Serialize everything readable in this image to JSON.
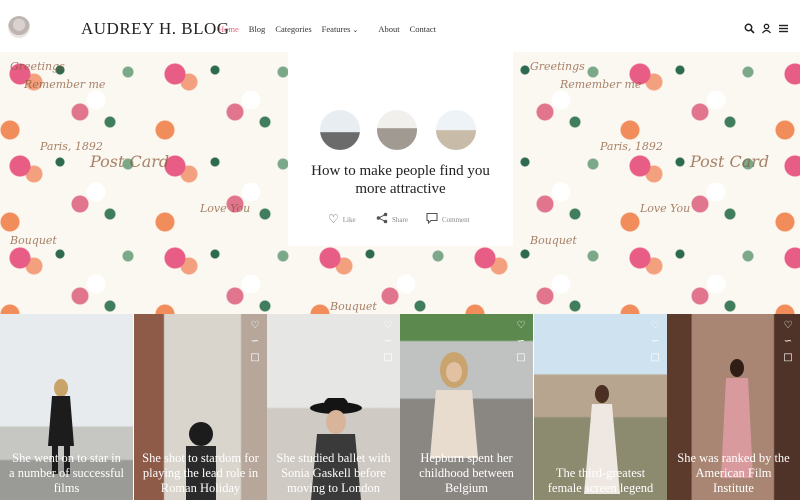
{
  "header": {
    "brand": "AUDREY H. BLOG",
    "nav": [
      "Home",
      "Blog",
      "Categories",
      "Features",
      "About",
      "Contact"
    ],
    "active_nav": "Home",
    "icons": [
      "search-icon",
      "user-icon",
      "menu-icon"
    ]
  },
  "hero": {
    "title": "How to make people find you more attractive",
    "actions": {
      "like": "Like",
      "share": "Share",
      "comment": "Comment"
    },
    "script_words": [
      "Greetings",
      "Remember me",
      "Paris, 1892",
      "Post Card",
      "Bouquet",
      "Love You"
    ]
  },
  "tiles": [
    {
      "caption": "She went on to star in a number of successful films"
    },
    {
      "caption": "She shot to stardom for playing the lead role in Roman Holiday"
    },
    {
      "caption": "She studied ballet with Sonia Gaskell before moving to London"
    },
    {
      "caption": "Hepburn spent her childhood between Belgium"
    },
    {
      "caption": "The third-greatest female screen legend"
    },
    {
      "caption": "She was ranked by the American Film Institute"
    }
  ],
  "colors": {
    "accent": "#e0657d",
    "text": "#222222"
  }
}
